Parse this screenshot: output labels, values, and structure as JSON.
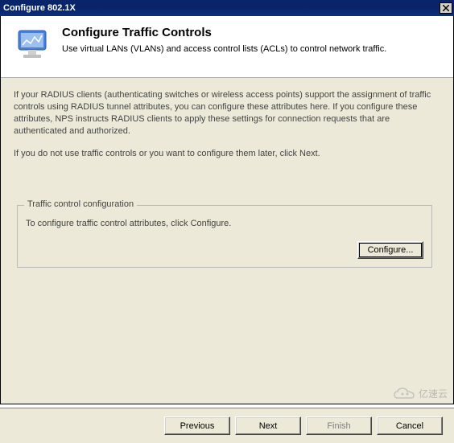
{
  "titlebar": {
    "title": "Configure 802.1X"
  },
  "header": {
    "heading": "Configure Traffic Controls",
    "subheading": "Use virtual LANs (VLANs) and access control lists (ACLs) to control network traffic."
  },
  "content": {
    "paragraph1": "If your RADIUS clients (authenticating switches or wireless access points) support the assignment of traffic controls using RADIUS tunnel attributes, you can configure these attributes here. If you configure these attributes, NPS instructs RADIUS clients to apply these settings for connection requests that are authenticated and authorized.",
    "paragraph2": "If you do not use traffic controls or you want to configure them later, click Next."
  },
  "groupbox": {
    "title": "Traffic control configuration",
    "text": "To configure traffic control attributes, click Configure.",
    "button": "Configure..."
  },
  "buttons": {
    "previous": "Previous",
    "next": "Next",
    "finish": "Finish",
    "cancel": "Cancel"
  },
  "watermark": "亿速云"
}
